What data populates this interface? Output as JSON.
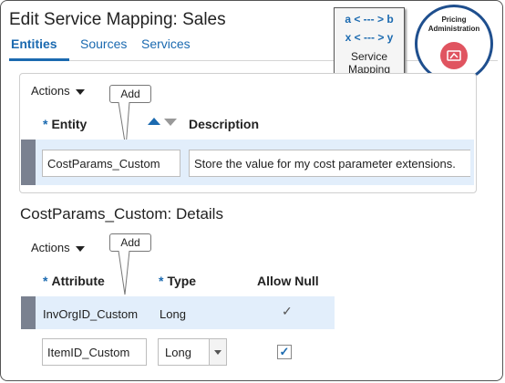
{
  "page": {
    "title": "Edit Service Mapping: Sales"
  },
  "tabs": [
    {
      "label": "Entities",
      "active": true
    },
    {
      "label": "Sources",
      "active": false
    },
    {
      "label": "Services",
      "active": false
    }
  ],
  "service_mapping_badge": {
    "line1": "a < --- > b",
    "line2": "x < --- > y",
    "label": "Service Mapping"
  },
  "pricing_admin_badge": {
    "label": "Pricing Administration",
    "icon": "pricing-icon"
  },
  "entities_section": {
    "actions_label": "Actions",
    "callout": "Add",
    "headers": {
      "entity": "Entity",
      "description": "Description"
    },
    "row": {
      "entity": "CostParams_Custom",
      "description": "Store the value for my cost parameter extensions."
    }
  },
  "details_section": {
    "title": "CostParams_Custom: Details",
    "actions_label": "Actions",
    "callout": "Add",
    "headers": {
      "attribute": "Attribute",
      "type": "Type",
      "allow_null": "Allow Null"
    },
    "rows": [
      {
        "attribute": "InvOrgID_Custom",
        "type": "Long",
        "allow_null": "✓"
      },
      {
        "attribute": "ItemID_Custom",
        "type": "Long",
        "allow_null": "✓"
      }
    ]
  },
  "colors": {
    "accent": "#1b6ab0",
    "selected_row": "#e2eefb",
    "badge_ring": "#1f4f8e",
    "badge_icon": "#e05460"
  }
}
